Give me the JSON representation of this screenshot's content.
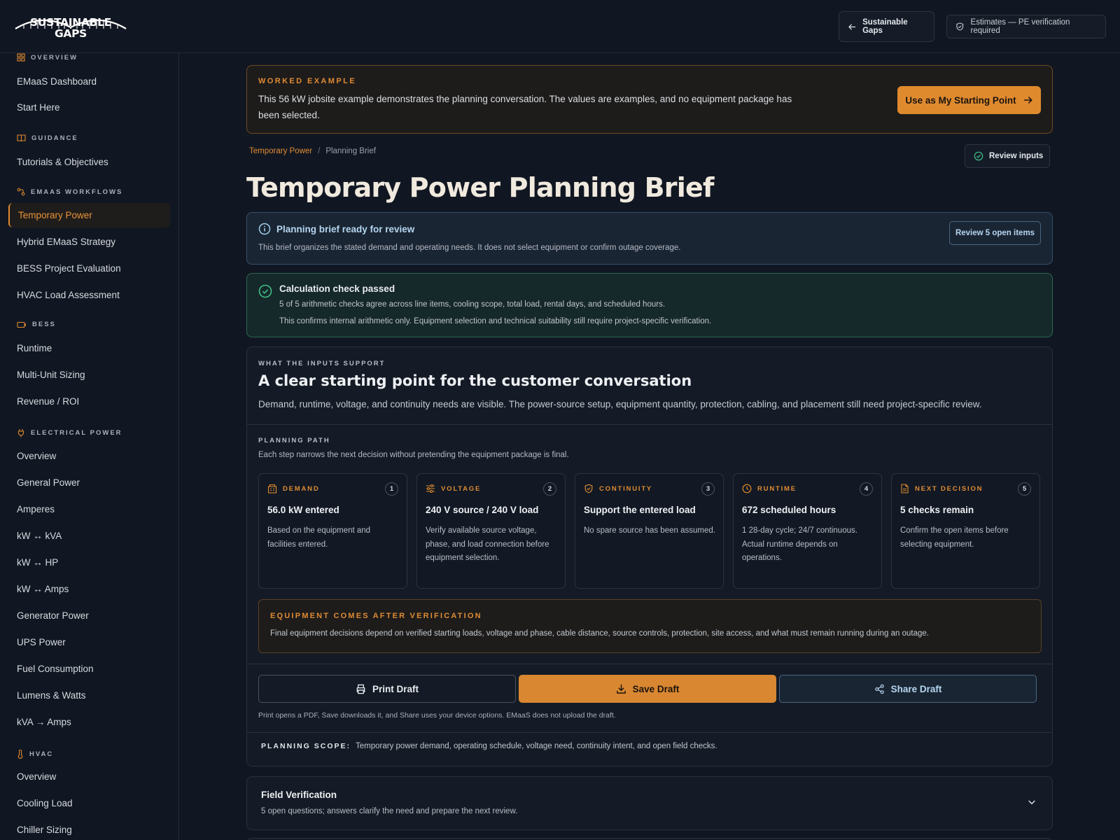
{
  "header": {
    "brand": "SUSTAINABLE GAPS",
    "back_label": "Sustainable Gaps",
    "estimate_label": "Estimates — PE verification required"
  },
  "sidebar": {
    "groups": [
      {
        "label": "OVERVIEW",
        "icon": "grid-icon",
        "items": [
          "EMaaS Dashboard",
          "Start Here"
        ]
      },
      {
        "label": "GUIDANCE",
        "icon": "book-icon",
        "items": [
          "Tutorials & Objectives"
        ]
      },
      {
        "label": "EMAAS WORKFLOWS",
        "icon": "workflow-icon",
        "items": [
          "Temporary Power",
          "Hybrid EMaaS Strategy",
          "BESS Project Evaluation",
          "HVAC Load Assessment"
        ]
      },
      {
        "label": "BESS",
        "icon": "battery-icon",
        "items": [
          "Runtime",
          "Multi-Unit Sizing",
          "Revenue / ROI"
        ]
      },
      {
        "label": "ELECTRICAL POWER",
        "icon": "plug-icon",
        "items": [
          "Overview",
          "General Power",
          "Amperes",
          "kW ↔ kVA",
          "kW ↔ HP",
          "kW ↔ Amps",
          "Generator Power",
          "UPS Power",
          "Fuel Consumption",
          "Lumens & Watts",
          "kVA → Amps"
        ]
      },
      {
        "label": "HVAC",
        "icon": "thermometer-icon",
        "items": [
          "Overview",
          "Cooling Load",
          "Chiller Sizing"
        ]
      }
    ],
    "active_item": "Temporary Power"
  },
  "worked_example": {
    "tag": "WORKED EXAMPLE",
    "description": "This 56 kW jobsite example demonstrates the planning conversation. The values are examples, and no equipment package has been selected.",
    "cta": "Use as My Starting Point"
  },
  "breadcrumb": {
    "parent": "Temporary Power",
    "sep": "/",
    "current": "Planning Brief"
  },
  "review_inputs_label": "Review inputs",
  "page_title": "Temporary Power Planning Brief",
  "info": {
    "title": "Planning brief ready for review",
    "text": "This brief organizes the stated demand and operating needs. It does not select equipment or confirm outage coverage.",
    "button": "Review 5 open items"
  },
  "check": {
    "title": "Calculation check passed",
    "line1": "5 of 5 arithmetic checks agree across line items, cooling scope, total load, rental days, and scheduled hours.",
    "line2": "This confirms internal arithmetic only. Equipment selection and technical suitability still require project-specific verification."
  },
  "support": {
    "eyebrow": "WHAT THE INPUTS SUPPORT",
    "heading": "A clear starting point for the customer conversation",
    "lead": "Demand, runtime, voltage, and continuity needs are visible. The power-source setup, equipment quantity, protection, cabling, and placement still need project-specific review.",
    "path_label": "PLANNING PATH",
    "path_sub": "Each step narrows the next decision without pretending the equipment package is final.",
    "steps": [
      {
        "label": "DEMAND",
        "num": "1",
        "icon": "building-icon",
        "value": "56.0 kW entered",
        "note": "Based on the equipment and facilities entered."
      },
      {
        "label": "VOLTAGE",
        "num": "2",
        "icon": "sliders-icon",
        "value": "240 V source / 240 V load",
        "note": "Verify available source voltage, phase, and load connection before equipment selection."
      },
      {
        "label": "CONTINUITY",
        "num": "3",
        "icon": "shield-icon",
        "value": "Support the entered load",
        "note": "No spare source has been assumed."
      },
      {
        "label": "RUNTIME",
        "num": "4",
        "icon": "clock-icon",
        "value": "672 scheduled hours",
        "note": "1 28-day cycle; 24/7 continuous. Actual runtime depends on operations."
      },
      {
        "label": "NEXT DECISION",
        "num": "5",
        "icon": "document-icon",
        "value": "5 checks remain",
        "note": "Confirm the open items before selecting equipment."
      }
    ],
    "verify_title": "EQUIPMENT COMES AFTER VERIFICATION",
    "verify_text": "Final equipment decisions depend on verified starting loads, voltage and phase, cable distance, source controls, protection, site access, and what must remain running during an outage.",
    "actions": {
      "print": "Print Draft",
      "save": "Save Draft",
      "share": "Share Draft"
    },
    "actions_note": "Print opens a PDF, Save downloads it, and Share uses your device options. EMaaS does not upload the draft.",
    "scope_label": "PLANNING SCOPE:",
    "scope_text": "Temporary power demand, operating schedule, voltage need, continuity intent, and open field checks."
  },
  "field_verification": {
    "title": "Field Verification",
    "subtitle": "5 open questions; answers clarify the need and prepare the next review."
  },
  "colors": {
    "accent": "#e08a2e",
    "info": "#b5d6ef",
    "success": "#3fbf86",
    "background": "#111722"
  }
}
